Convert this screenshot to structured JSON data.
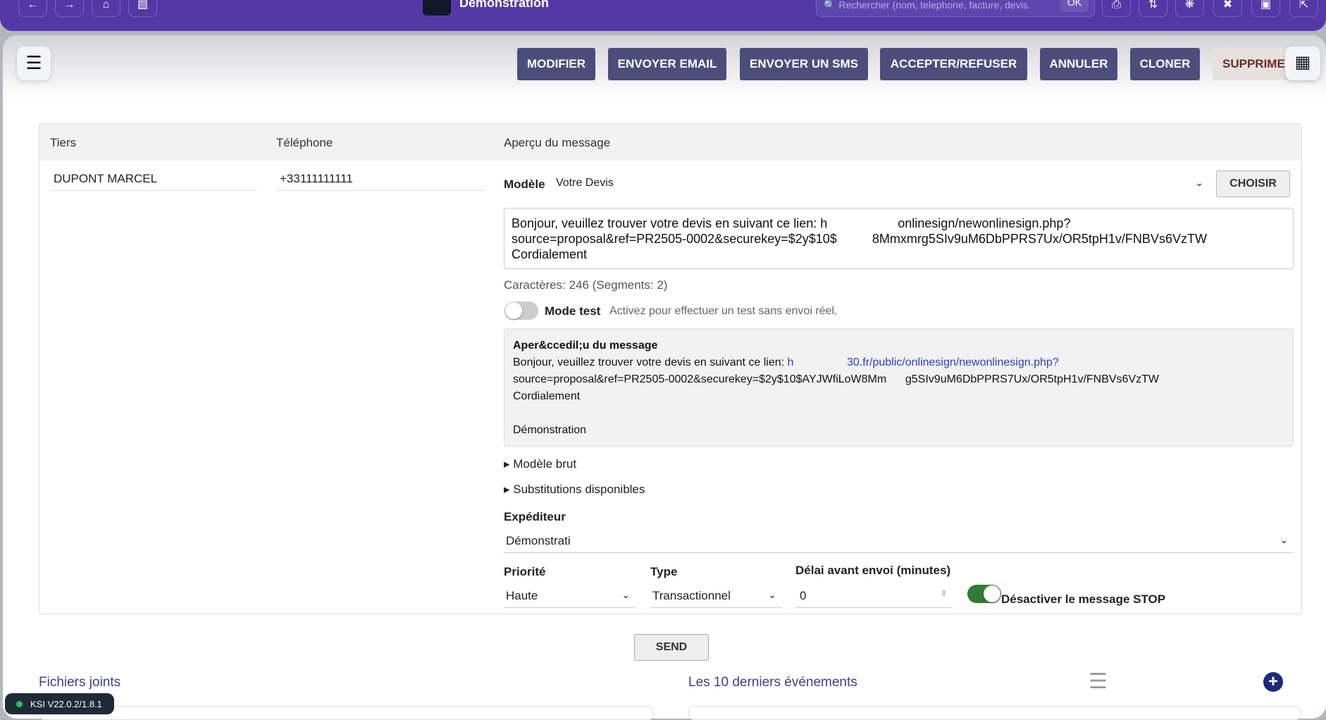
{
  "topbar": {
    "title": "Démonstration",
    "search_placeholder": "Rechercher (nom, telephone, facture, devis.",
    "search_ok": "OK"
  },
  "actions": {
    "modifier": "MODIFIER",
    "email": "ENVOYER EMAIL",
    "sms": "ENVOYER UN SMS",
    "accept": "ACCEPTER/REFUSER",
    "annuler": "ANNULER",
    "cloner": "CLONER",
    "supprimer": "SUPPRIME"
  },
  "table": {
    "headers": [
      "Tiers",
      "Téléphone",
      "Aperçu du message"
    ],
    "tiers": "DUPONT MARCEL",
    "telephone": "+33111111111"
  },
  "form": {
    "modele_label": "Modèle",
    "modele_value": "Votre Devis",
    "choisir": "CHOISIR",
    "message": "Bonjour, veuillez trouver votre devis en suivant ce lien: h                    onlinesign/newonlinesign.php?\nsource=proposal&ref=PR2505-0002&securekey=$2y$10$          8Mmxmrg5SIv9uM6DbPPRS7Ux/OR5tpH1v/FNBVs6VzTW\nCordialement",
    "chars": "Caractères: 246 (Segments: 2)",
    "mode_test_label": "Mode test",
    "mode_test_hint": "Activez pour effectuer un test sans envoi réel.",
    "preview_title": "Aper&ccedil;u du message",
    "preview_line1": "Bonjour, veuillez trouver votre devis en suivant ce lien: ",
    "preview_link": "h                 30.fr/public/onlinesign/newonlinesign.php?",
    "preview_rest": "source=proposal&ref=PR2505-0002&securekey=$2y$10$AYJWfiLoW8Mm      g5SIv9uM6DbPPRS7Ux/OR5tpH1v/FNBVs6VzTW\nCordialement\n\nDémonstration",
    "modele_brut": "Modèle brut",
    "substitutions": "Substitutions disponibles",
    "expediteur_label": "Expéditeur",
    "expediteur_value": "Démonstrati",
    "priorite_label": "Priorité",
    "priorite_value": "Haute",
    "type_label": "Type",
    "type_value": "Transactionnel",
    "delai_label": "Délai avant envoi (minutes)",
    "delai_value": "0",
    "stop_label": "Désactiver le message STOP",
    "send": "SEND"
  },
  "bottom": {
    "files": "Fichiers joints",
    "events": "Les 10 derniers événements"
  },
  "version": "KSI V22.0.2/1.8.1"
}
